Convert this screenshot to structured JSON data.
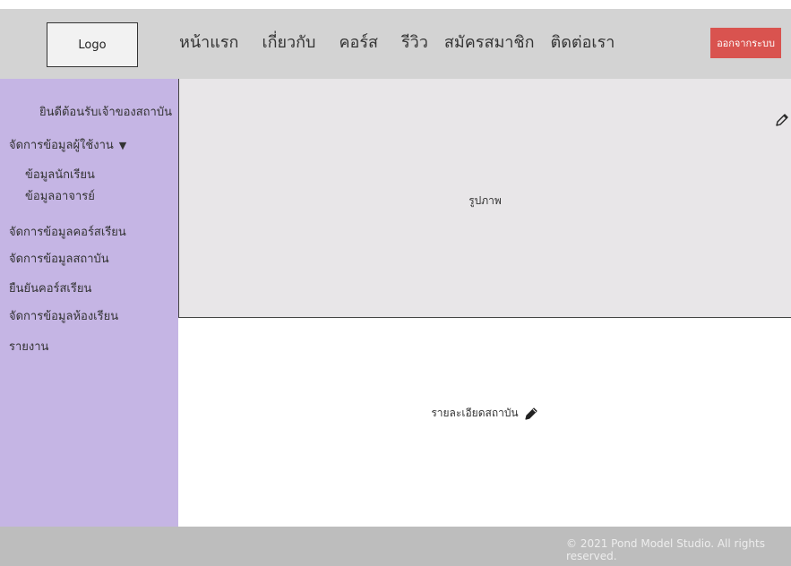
{
  "header": {
    "logo_text": "Logo",
    "nav": [
      "หน้าแรก",
      "เกี่ยวกับ",
      "คอร์ส",
      "รีวิว",
      "สมัครสมาชิก",
      "ติดต่อเรา"
    ],
    "logout_label": "ออกจากระบบ"
  },
  "sidebar": {
    "welcome": "ยินดีต้อนรับเจ้าของสถาบัน",
    "items": [
      "จัดการข้อมูลผู้ใช้งาน",
      "ข้อมูลนักเรียน",
      "ข้อมูลอาจารย์",
      "จัดการข้อมูลคอร์สเรียน",
      "จัดการข้อมูลสถาบัน",
      "ยืนยันคอร์สเรียน",
      "จัดการข้อมูลห้องเรียน",
      "รายงาน"
    ],
    "caret_symbol": "▼"
  },
  "main": {
    "image_label": "รูปภาพ",
    "details_label": "รายละเอียดสถาบัน"
  },
  "footer": {
    "copyright": "© 2021 Pond Model Studio. All rights reserved."
  },
  "colors": {
    "topbar": "#d3d3d3",
    "sidebar": "#c5b5e4",
    "logout": "#d9534f",
    "hero": "#e8e6e8",
    "footer": "#bdbdbd"
  },
  "icons": [
    "pencil-icon"
  ]
}
